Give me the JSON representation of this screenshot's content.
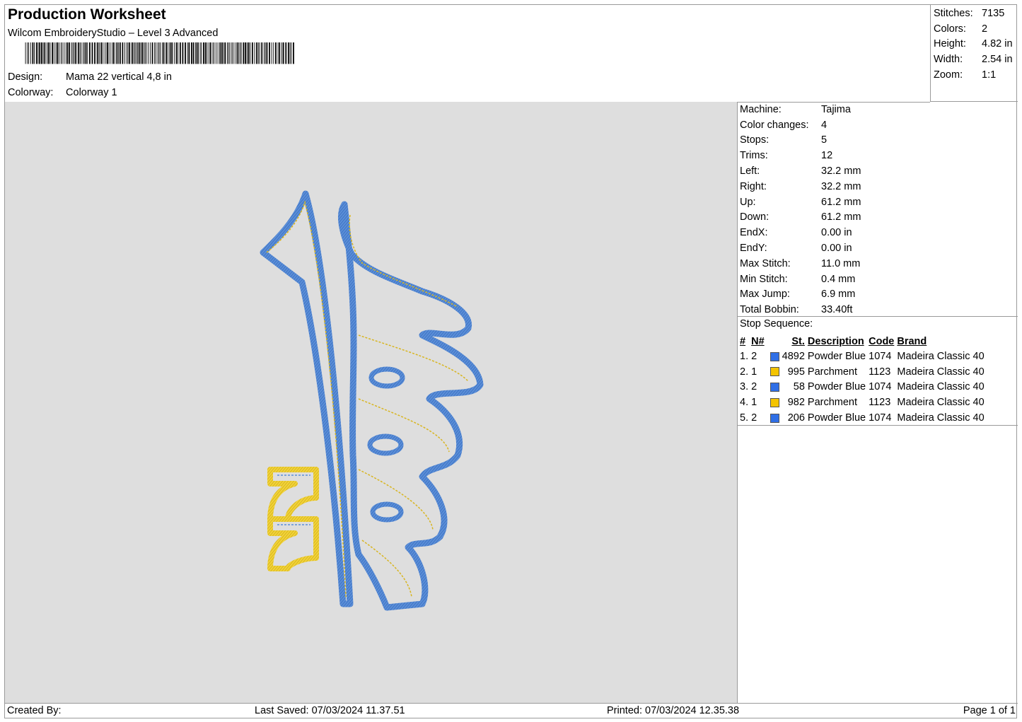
{
  "header": {
    "title": "Production Worksheet",
    "software": "Wilcom EmbroideryStudio – Level 3 Advanced",
    "design_label": "Design:",
    "design_value": "Mama 22 vertical 4,8 in",
    "colorway_label": "Colorway:",
    "colorway_value": "Colorway 1"
  },
  "summary": [
    {
      "k": "Stitches:",
      "v": "7135"
    },
    {
      "k": "Colors:",
      "v": "2"
    },
    {
      "k": "Height:",
      "v": "4.82 in"
    },
    {
      "k": "Width:",
      "v": "2.54 in"
    },
    {
      "k": "Zoom:",
      "v": "1:1"
    }
  ],
  "info": [
    {
      "k": "Machine:",
      "v": "Tajima"
    },
    {
      "k": "Color changes:",
      "v": "4"
    },
    {
      "k": "Stops:",
      "v": "5"
    },
    {
      "k": "Trims:",
      "v": "12"
    },
    {
      "k": "Left:",
      "v": "32.2 mm"
    },
    {
      "k": "Right:",
      "v": "32.2 mm"
    },
    {
      "k": "Up:",
      "v": "61.2 mm"
    },
    {
      "k": "Down:",
      "v": "61.2 mm"
    },
    {
      "k": "EndX:",
      "v": "0.00 in"
    },
    {
      "k": "EndY:",
      "v": "0.00 in"
    },
    {
      "k": "Max Stitch:",
      "v": "11.0 mm"
    },
    {
      "k": "Min Stitch:",
      "v": "0.4 mm"
    },
    {
      "k": "Max Jump:",
      "v": "6.9 mm"
    },
    {
      "k": "Total Bobbin:",
      "v": "33.40ft"
    }
  ],
  "sequence": {
    "title": "Stop Sequence:",
    "headers": {
      "num": "#",
      "n": "N#",
      "st": "St.",
      "desc": "Description",
      "code": "Code",
      "brand": "Brand"
    },
    "rows": [
      {
        "num": "1.",
        "n": "2",
        "color": "#2f6fe6",
        "st": "4892",
        "desc": "Powder Blue",
        "code": "1074",
        "brand": "Madeira Classic 40"
      },
      {
        "num": "2.",
        "n": "1",
        "color": "#f4c400",
        "st": "995",
        "desc": "Parchment",
        "code": "1123",
        "brand": "Madeira Classic 40"
      },
      {
        "num": "3.",
        "n": "2",
        "color": "#2f6fe6",
        "st": "58",
        "desc": "Powder Blue",
        "code": "1074",
        "brand": "Madeira Classic 40"
      },
      {
        "num": "4.",
        "n": "1",
        "color": "#f4c400",
        "st": "982",
        "desc": "Parchment",
        "code": "1123",
        "brand": "Madeira Classic 40"
      },
      {
        "num": "5.",
        "n": "2",
        "color": "#2f6fe6",
        "st": "206",
        "desc": "Powder Blue",
        "code": "1074",
        "brand": "Madeira Classic 40"
      }
    ]
  },
  "footer": {
    "created": "Created By:",
    "saved": "Last Saved: 07/03/2024 11.37.51",
    "printed": "Printed: 07/03/2024 12.35.38",
    "page": "Page 1 of 1"
  },
  "colors": {
    "thread_blue": "#5b8fd8",
    "thread_yellow": "#f2d43a",
    "canvas_bg": "#dedede"
  }
}
